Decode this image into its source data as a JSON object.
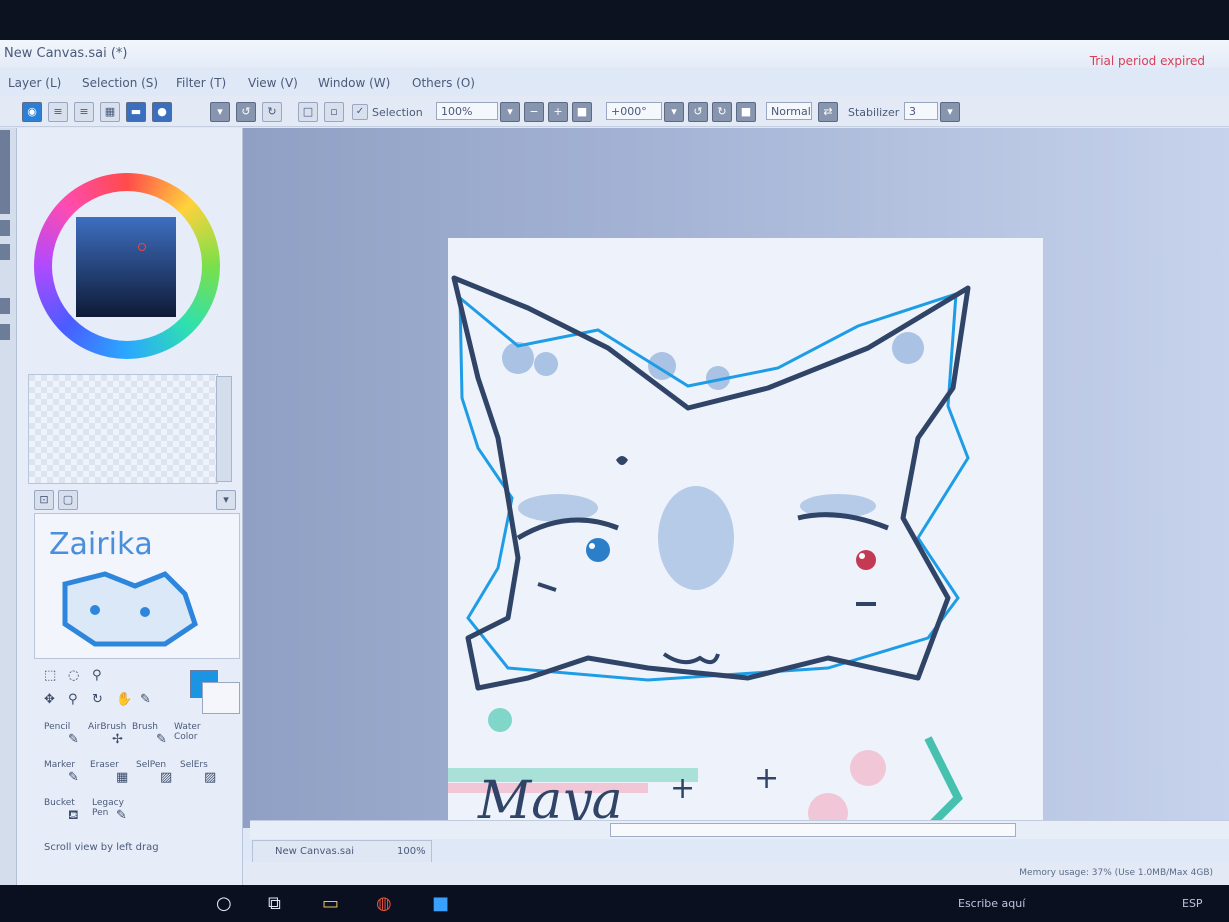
{
  "window": {
    "title": "New Canvas.sai (*)",
    "trial_notice": "Trial period expired"
  },
  "menu": [
    "Layer (L)",
    "Selection (S)",
    "Filter (T)",
    "View (V)",
    "Window (W)",
    "Others (O)"
  ],
  "toolbar": {
    "selection_label": "Selection",
    "zoom_value": "100%",
    "rotation_value": "+000°",
    "blend_mode": "Normal",
    "stabilizer_label": "Stabilizer",
    "stabilizer_value": "3"
  },
  "tools": {
    "brushes": [
      "Pencil",
      "AirBrush",
      "Brush",
      "Water Color",
      "Marker",
      "Eraser",
      "SelPen",
      "SelErs",
      "Bucket",
      "Legacy Pen"
    ],
    "hint": "Scroll view by left drag",
    "fg_color": "#1c94e4"
  },
  "doc_tab": {
    "name": "New Canvas.sai",
    "zoom": "100%"
  },
  "status": {
    "memory": "Memory usage: 37% (Use 1.0MB/Max 4GB)"
  },
  "taskbar": {
    "search_placeholder": "Escribe aquí",
    "lang": "ESP"
  },
  "drawing": {
    "signature_text": "Maya",
    "thumbnail_text": "Zairikа"
  }
}
